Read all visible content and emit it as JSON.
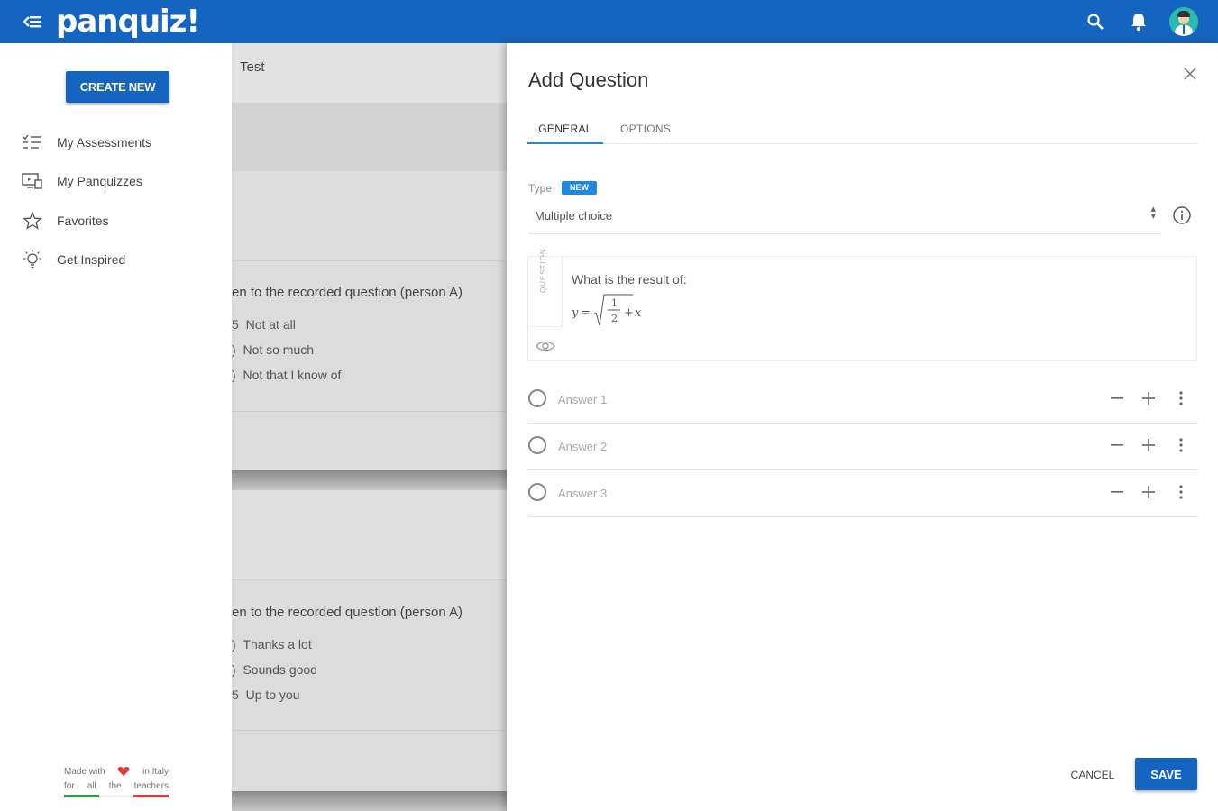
{
  "app": {
    "logo": "panquiz!",
    "colors": {
      "primary": "#1565c0",
      "accent": "#1e88e5",
      "heart": "#e53935"
    }
  },
  "topbar": {
    "icons": [
      "menu-back-icon",
      "search-icon",
      "bell-icon",
      "avatar"
    ]
  },
  "sidebar": {
    "create_label": "CREATE NEW",
    "items": [
      {
        "label": "My Assessments",
        "icon": "list-icon"
      },
      {
        "label": "My Panquizzes",
        "icon": "screen-icon"
      },
      {
        "label": "Favorites",
        "icon": "star-icon"
      },
      {
        "label": "Get Inspired",
        "icon": "lightbulb-icon"
      }
    ],
    "footer": {
      "made_with": "Made with",
      "in_italy": "in Italy",
      "for_teachers": [
        "for",
        "all",
        "the",
        "teachers"
      ]
    }
  },
  "background": {
    "title_fragment": "Test",
    "q1": "en to the recorded question (person A)",
    "q1_options": [
      "Not at all",
      "Not so much",
      "Not that I know of"
    ],
    "q2": "en to the recorded question (person A)",
    "q2_options": [
      "Thanks a lot",
      "Sounds good",
      "Up to you"
    ]
  },
  "dialog": {
    "title": "Add Question",
    "tabs": [
      {
        "label": "GENERAL",
        "active": true
      },
      {
        "label": "OPTIONS",
        "active": false
      }
    ],
    "type_label": "Type",
    "new_badge": "NEW",
    "type_value": "Multiple choice",
    "question_vertical_label": "QUESTION",
    "question_text": "What is the result of:",
    "formula": {
      "lhs": "y",
      "eq": "=",
      "numerator": "1",
      "denominator": "2",
      "op": "+",
      "var": "x"
    },
    "answers": [
      {
        "placeholder": "Answer 1"
      },
      {
        "placeholder": "Answer 2"
      },
      {
        "placeholder": "Answer 3"
      }
    ],
    "cancel_label": "CANCEL",
    "save_label": "SAVE"
  }
}
